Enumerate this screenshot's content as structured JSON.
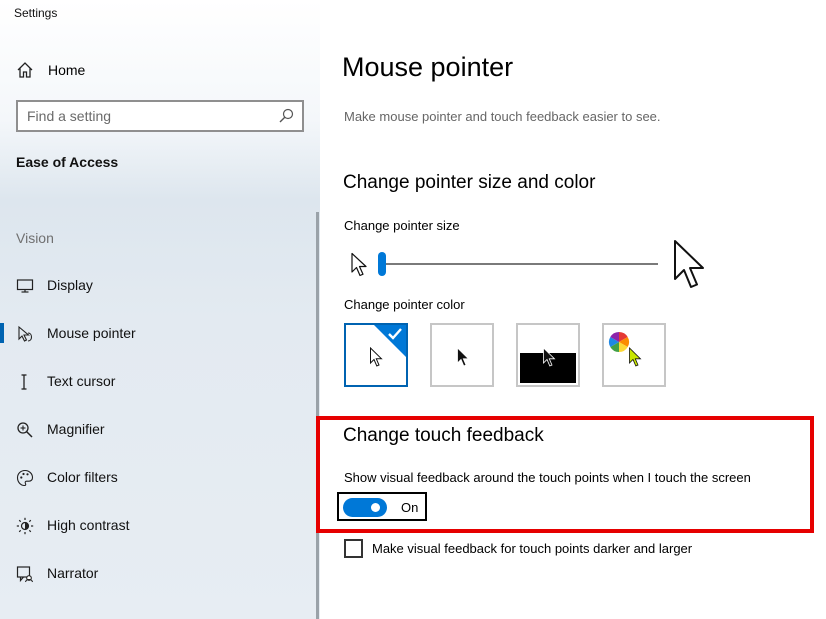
{
  "window": {
    "title": "Settings"
  },
  "sidebar": {
    "home_label": "Home",
    "search_placeholder": "Find a setting",
    "section_title": "Ease of Access",
    "group_label": "Vision",
    "items": [
      {
        "label": "Display",
        "icon": "monitor-icon"
      },
      {
        "label": "Mouse pointer",
        "icon": "mouse-pointer-icon",
        "selected": true
      },
      {
        "label": "Text cursor",
        "icon": "text-cursor-icon"
      },
      {
        "label": "Magnifier",
        "icon": "magnifier-icon"
      },
      {
        "label": "Color filters",
        "icon": "color-filters-icon"
      },
      {
        "label": "High contrast",
        "icon": "high-contrast-icon"
      },
      {
        "label": "Narrator",
        "icon": "narrator-icon"
      }
    ]
  },
  "main": {
    "title": "Mouse pointer",
    "description": "Make mouse pointer and touch feedback easier to see.",
    "pointer_section": {
      "heading": "Change pointer size and color",
      "size_label": "Change pointer size",
      "size_value": 1,
      "color_label": "Change pointer color",
      "color_options": [
        {
          "name": "white",
          "selected": true
        },
        {
          "name": "black",
          "selected": false
        },
        {
          "name": "inverted",
          "selected": false
        },
        {
          "name": "custom",
          "selected": false
        }
      ]
    },
    "touch_section": {
      "heading": "Change touch feedback",
      "toggle_label": "Show visual feedback around the touch points when I touch the screen",
      "toggle_state": "On",
      "checkbox_label": "Make visual feedback for touch points darker and larger",
      "checkbox_checked": false
    }
  },
  "colors": {
    "accent": "#0078d7",
    "highlight_box": "#e60000",
    "custom_pointer": "#c8e600"
  }
}
